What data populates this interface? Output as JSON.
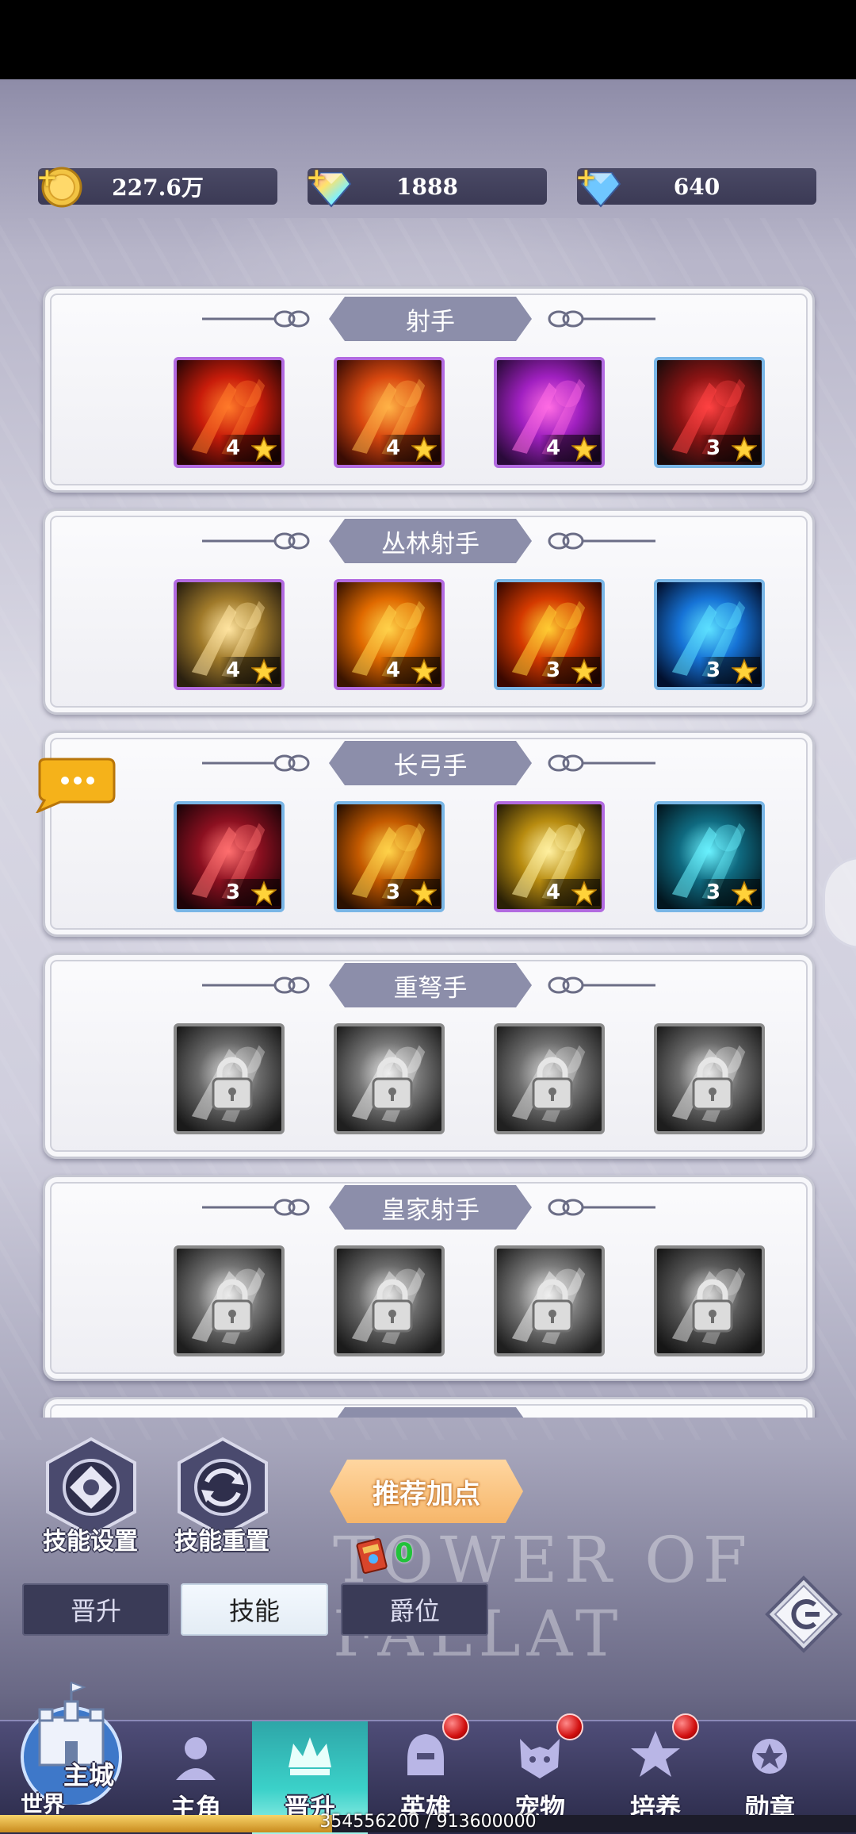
{
  "currencies": [
    {
      "name": "gold",
      "value": "227.6万",
      "icon": "gold-coin-icon"
    },
    {
      "name": "rainbow-gem",
      "value": "1888",
      "icon": "rainbow-diamond-icon"
    },
    {
      "name": "blue-gem",
      "value": "640",
      "icon": "blue-diamond-icon"
    }
  ],
  "categories": [
    {
      "title": "射手",
      "skills": [
        {
          "level": "4",
          "frame": "purple",
          "locked": false,
          "art": "arrows"
        },
        {
          "level": "4",
          "frame": "purple",
          "locked": false,
          "art": "meteors"
        },
        {
          "level": "4",
          "frame": "purple",
          "locked": false,
          "art": "dancer"
        },
        {
          "level": "3",
          "frame": "blue",
          "locked": false,
          "art": "butterfly"
        }
      ]
    },
    {
      "title": "丛林射手",
      "skills": [
        {
          "level": "4",
          "frame": "purple",
          "locked": false,
          "art": "spikes"
        },
        {
          "level": "4",
          "frame": "purple",
          "locked": false,
          "art": "fire-rain"
        },
        {
          "level": "3",
          "frame": "blue",
          "locked": false,
          "art": "explosion"
        },
        {
          "level": "3",
          "frame": "blue",
          "locked": false,
          "art": "aura"
        }
      ]
    },
    {
      "title": "长弓手",
      "skills": [
        {
          "level": "3",
          "frame": "blue",
          "locked": false,
          "art": "arrowhead"
        },
        {
          "level": "3",
          "frame": "blue",
          "locked": false,
          "art": "flame-man"
        },
        {
          "level": "4",
          "frame": "purple",
          "locked": false,
          "art": "slash"
        },
        {
          "level": "3",
          "frame": "blue",
          "locked": false,
          "art": "ghost"
        }
      ]
    },
    {
      "title": "重弩手",
      "skills": [
        {
          "level": "",
          "frame": "gray",
          "locked": true,
          "art": "shield"
        },
        {
          "level": "",
          "frame": "gray",
          "locked": true,
          "art": "bolt"
        },
        {
          "level": "",
          "frame": "gray",
          "locked": true,
          "art": "orb"
        },
        {
          "level": "",
          "frame": "gray",
          "locked": true,
          "art": "storm"
        }
      ]
    },
    {
      "title": "皇家射手",
      "skills": [
        {
          "level": "",
          "frame": "gray",
          "locked": true,
          "art": "dash"
        },
        {
          "level": "",
          "frame": "gray",
          "locked": true,
          "art": "claw"
        },
        {
          "level": "",
          "frame": "gray",
          "locked": true,
          "art": "vortex"
        },
        {
          "level": "",
          "frame": "gray",
          "locked": true,
          "art": "beast"
        }
      ]
    }
  ],
  "controls": {
    "skill_settings": "技能设置",
    "skill_reset": "技能重置",
    "recommend": "推荐加点",
    "book_count": "0",
    "watermark": "TOWER OF FALLAT"
  },
  "tabs": [
    {
      "label": "晋升",
      "active": false
    },
    {
      "label": "技能",
      "active": true
    },
    {
      "label": "爵位",
      "active": false
    }
  ],
  "nav": {
    "main_city": "主城",
    "world": "世界",
    "items": [
      {
        "label": "主角",
        "icon": "hero-portrait-icon",
        "active": false,
        "badge": false
      },
      {
        "label": "晋升",
        "icon": "promotion-crown-icon",
        "active": true,
        "badge": false
      },
      {
        "label": "英雄",
        "icon": "helmet-icon",
        "active": false,
        "badge": true
      },
      {
        "label": "宠物",
        "icon": "pet-beast-icon",
        "active": false,
        "badge": true
      },
      {
        "label": "培养",
        "icon": "cultivate-star-icon",
        "active": false,
        "badge": true
      },
      {
        "label": "勋章",
        "icon": "medal-icon",
        "active": false,
        "badge": false
      }
    ]
  },
  "exp": {
    "text": "354556200 / 913600000",
    "progress": 0.388
  },
  "colors": {
    "ribbon": "#8c8eaa",
    "purple_frame": "#b26ae0",
    "blue_frame": "#79b6e6",
    "active_tab": "#3bd1c9"
  }
}
